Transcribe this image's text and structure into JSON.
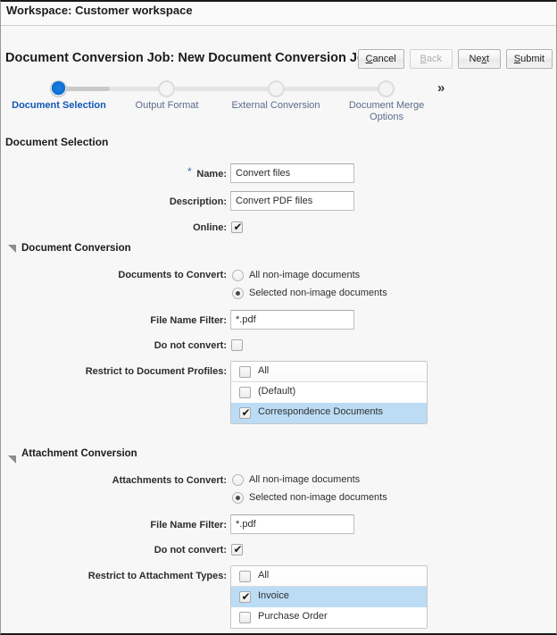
{
  "workspace": {
    "title": "Workspace: Customer workspace"
  },
  "header": {
    "title": "Document Conversion Job: New Document Conversion Job",
    "buttons": [
      {
        "label": "Cancel",
        "accesskey_index": 0,
        "disabled": false,
        "name": "cancel-button"
      },
      {
        "label": "Back",
        "accesskey_index": 0,
        "disabled": true,
        "name": "back-button"
      },
      {
        "label": "Next",
        "accesskey_index": 2,
        "disabled": false,
        "name": "next-button"
      },
      {
        "label": "Submit",
        "accesskey_index": 0,
        "disabled": false,
        "name": "submit-button"
      }
    ]
  },
  "train": {
    "steps": [
      {
        "label": "Document Selection",
        "state": "active"
      },
      {
        "label": "Output Format",
        "state": "inactive"
      },
      {
        "label": "External Conversion",
        "state": "inactive"
      },
      {
        "label": "Document Merge Options",
        "state": "inactive"
      }
    ],
    "overflow_icon": "»"
  },
  "main": {
    "section_title": "Document Selection",
    "name": {
      "label": "Name:",
      "required_marker": "*",
      "value": "Convert files"
    },
    "description": {
      "label": "Description:",
      "value": "Convert PDF files"
    },
    "online": {
      "label": "Online:",
      "checked": true
    },
    "document_conversion": {
      "title": "Document Conversion",
      "documents_to_convert": {
        "label": "Documents to Convert:",
        "options": [
          {
            "label": "All non-image documents",
            "selected": false
          },
          {
            "label": "Selected non-image documents",
            "selected": true
          }
        ]
      },
      "file_name_filter": {
        "label": "File Name Filter:",
        "value": "*.pdf"
      },
      "do_not_convert": {
        "label": "Do not convert:",
        "checked": false
      },
      "restrict_profiles": {
        "label": "Restrict to Document Profiles:",
        "rows": [
          {
            "label": "All",
            "checked": false,
            "header": true,
            "selected": false
          },
          {
            "label": "(Default)",
            "checked": false,
            "header": false,
            "selected": false
          },
          {
            "label": "Correspondence Documents",
            "checked": true,
            "header": false,
            "selected": true
          }
        ]
      }
    },
    "attachment_conversion": {
      "title": "Attachment Conversion",
      "attachments_to_convert": {
        "label": "Attachments to Convert:",
        "options": [
          {
            "label": "All non-image documents",
            "selected": false
          },
          {
            "label": "Selected non-image documents",
            "selected": true
          }
        ]
      },
      "file_name_filter": {
        "label": "File Name Filter:",
        "value": "*.pdf"
      },
      "do_not_convert": {
        "label": "Do not convert:",
        "checked": true
      },
      "restrict_attachment_types": {
        "label": "Restrict to Attachment Types:",
        "rows": [
          {
            "label": "All",
            "checked": false,
            "header": true,
            "selected": false
          },
          {
            "label": "Invoice",
            "checked": true,
            "header": false,
            "selected": true
          },
          {
            "label": "Purchase Order",
            "checked": false,
            "header": false,
            "selected": false
          }
        ]
      }
    }
  },
  "colors": {
    "accent": "#0b6ed6",
    "train_active_label": "#1158b5",
    "train_label": "#5b6b8c",
    "row_selected": "#bcdcf5",
    "required": "#3a6fb5"
  }
}
